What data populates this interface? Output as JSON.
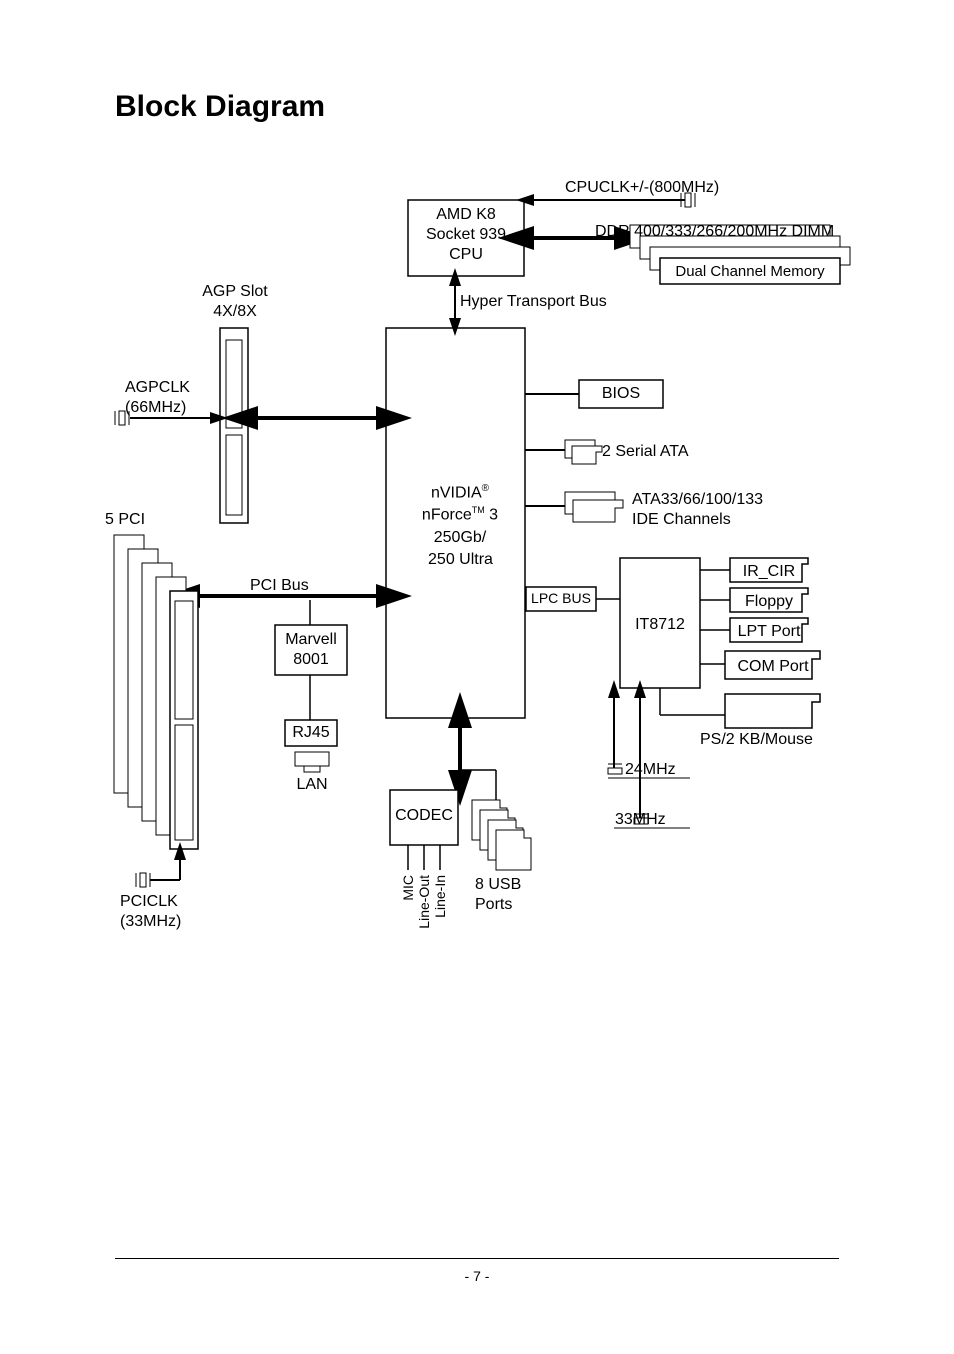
{
  "title": "Block Diagram",
  "cpu": {
    "line1": "AMD K8",
    "line2": "Socket 939",
    "line3": "CPU"
  },
  "cpuclk": "CPUCLK+/-(800MHz)",
  "ddr": "DDR 400/333/266/200MHz DIMM",
  "dual_channel": "Dual Channel Memory",
  "agp_slot": {
    "line1": "AGP Slot",
    "line2": "4X/8X"
  },
  "hyper": "Hyper Transport Bus",
  "agpclk": {
    "line1": "AGPCLK",
    "line2": "(66MHz)"
  },
  "chipset": {
    "line1": "nVIDIA",
    "reg": "®",
    "line2": "nForce",
    "tm": "TM",
    "line2b": " 3",
    "line3": "250Gb/",
    "line4": "250 Ultra"
  },
  "bios": "BIOS",
  "sata": "2 Serial ATA",
  "ide": {
    "line1": "ATA33/66/100/133",
    "line2": "IDE Channels"
  },
  "pci5": "5 PCI",
  "pci_bus": "PCI Bus",
  "lpc_bus": "LPC BUS",
  "marvell": {
    "line1": "Marvell",
    "line2": "8001"
  },
  "rj45": "RJ45",
  "lan": "LAN",
  "it8712": "IT8712",
  "ir_cir": "IR_CIR",
  "floppy": "Floppy",
  "lpt": "LPT Port",
  "com": "COM Port",
  "ps2": "PS/2 KB/Mouse",
  "codec": "CODEC",
  "clk24": "24MHz",
  "clk33": "33MHz",
  "pciclk": {
    "line1": "PCICLK",
    "line2": "(33MHz)"
  },
  "audio": {
    "mic": "MIC",
    "lineout": "Line-Out",
    "linein": "Line-In"
  },
  "usb": {
    "line1": "8 USB",
    "line2": "Ports"
  },
  "page_number": "- 7 -"
}
